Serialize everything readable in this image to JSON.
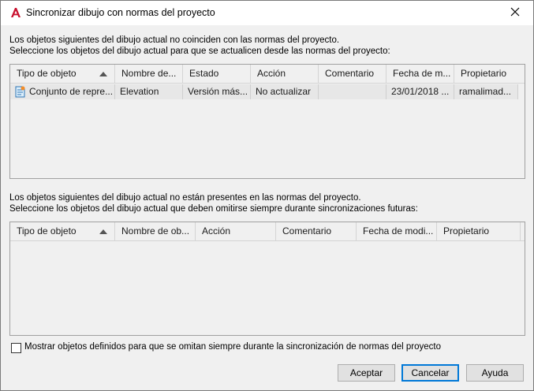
{
  "window": {
    "title": "Sincronizar dibujo con normas del proyecto",
    "icon": "autocad-a-icon",
    "accent": "#c8102e"
  },
  "section1": {
    "line1": "Los objetos siguientes del dibujo actual no coinciden con las normas del proyecto.",
    "line2": "Seleccione los objetos del dibujo actual para que se actualicen desde las normas del proyecto:",
    "columns": [
      "Tipo de objeto",
      "Nombre de...",
      "Estado",
      "Acción",
      "Comentario",
      "Fecha de m...",
      "Propietario"
    ],
    "rows": [
      {
        "tipo": "Conjunto de repre...",
        "nombre": "Elevation",
        "estado": "Versión más...",
        "accion": "No actualizar",
        "comentario": "",
        "fecha": "23/01/2018 ...",
        "propietario": "ramalimad..."
      }
    ]
  },
  "section2": {
    "line1": "Los objetos siguientes del dibujo actual no están presentes en las normas del proyecto.",
    "line2": "Seleccione los objetos del dibujo actual que deben omitirse siempre durante sincronizaciones futuras:",
    "columns": [
      "Tipo de objeto",
      "Nombre de ob...",
      "Acción",
      "Comentario",
      "Fecha de modi...",
      "Propietario"
    ]
  },
  "footer": {
    "checkbox_label": "Mostrar objetos definidos para que se omitan siempre durante la sincronización de normas del proyecto",
    "checkbox_checked": false,
    "accept": "Aceptar",
    "cancel": "Cancelar",
    "help": "Ayuda"
  }
}
